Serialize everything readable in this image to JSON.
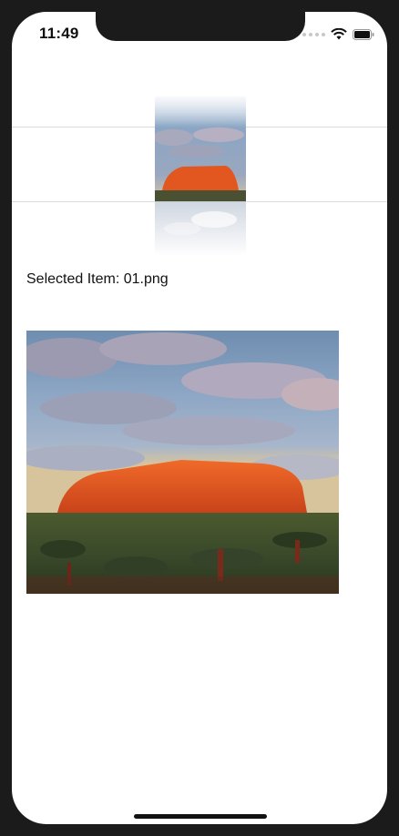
{
  "status_bar": {
    "time": "11:49",
    "signal_icon": "signal-dots-icon",
    "wifi_icon": "wifi-icon",
    "battery_icon": "battery-icon"
  },
  "carousel": {
    "items": [
      {
        "name": "01.png",
        "selected": true
      }
    ]
  },
  "selected_label": "Selected Item: 01.png",
  "preview": {
    "image_name": "01.png"
  },
  "colors": {
    "sky_top": "#7fa0c0",
    "cloud": "#b9b2c2",
    "rock": "#e0551e",
    "ground": "#3b4b2a",
    "separator": "#dadada"
  }
}
